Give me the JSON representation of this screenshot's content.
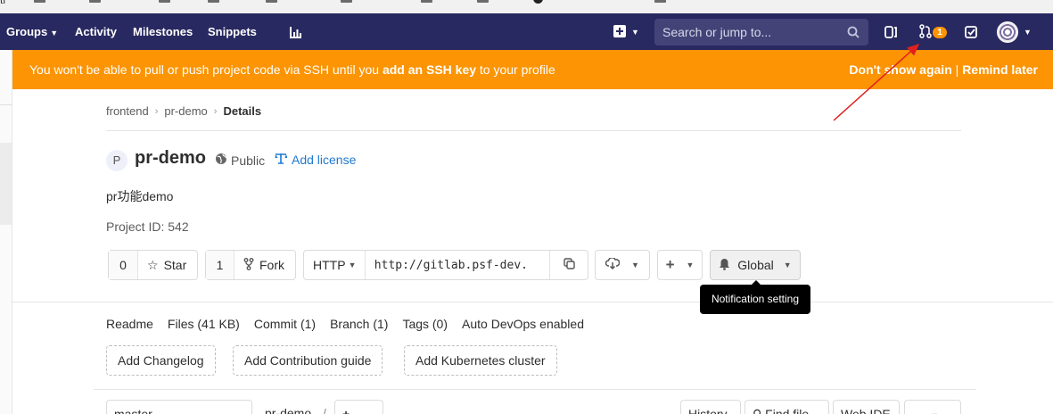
{
  "bookmarks": [
    "tl",
    "",
    "",
    "",
    "",
    "",
    "",
    ""
  ],
  "navbar": {
    "groups_label": "Groups",
    "activity_label": "Activity",
    "milestones_label": "Milestones",
    "snippets_label": "Snippets",
    "search_placeholder": "Search or jump to...",
    "merge_requests_count": "1",
    "icons": [
      "chart-icon",
      "plus-icon",
      "search-icon",
      "issues-icon",
      "merge-request-icon",
      "todo-icon",
      "avatar"
    ],
    "bg_color": "#292961"
  },
  "banner": {
    "message_prefix": "You won't be able to pull or push project code via SSH until you",
    "message_link": "add an SSH key",
    "message_suffix": "to your profile",
    "dont_show_again": "Don't show again",
    "separator": "|",
    "remind_later": "Remind later",
    "bg_color": "#fc9403"
  },
  "breadcrumb": {
    "items": [
      "frontend",
      "pr-demo"
    ],
    "current": "Details"
  },
  "project": {
    "avatar_letter": "P",
    "name": "pr-demo",
    "visibility": "Public",
    "add_license": "Add license",
    "description": "pr功能demo",
    "project_id": "Project ID: 542"
  },
  "toolbar": {
    "star_count": "0",
    "star_label": "Star",
    "fork_count": "1",
    "fork_label": "Fork",
    "protocol": "HTTP",
    "clone_url": "http://gitlab.psf-dev.",
    "notification_level": "Global",
    "tooltip": "Notification setting"
  },
  "stats": {
    "readme": "Readme",
    "files": "Files (41 KB)",
    "commit": "Commit (1)",
    "branch": "Branch (1)",
    "tags": "Tags (0)",
    "auto_devops": "Auto DevOps enabled"
  },
  "add_buttons": {
    "changelog": "Add Changelog",
    "contribution": "Add Contribution guide",
    "kubernetes": "Add Kubernetes cluster"
  },
  "file_bar": {
    "branch": "master",
    "path_root": "pr-demo",
    "path_sep": "/",
    "add": "+",
    "history": "History",
    "find_file": "Find file",
    "web_ide": "Web IDE"
  },
  "annotation_color": "#e0201e"
}
